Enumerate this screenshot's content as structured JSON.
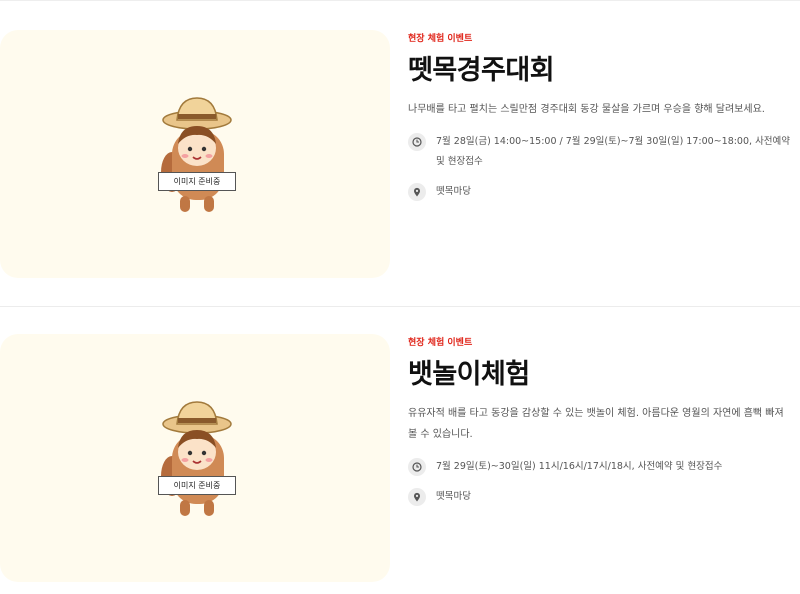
{
  "events": [
    {
      "badge": "현장 체험 이벤트",
      "title": "뗏목경주대회",
      "description": "나무배를 타고 펼치는 스릴만점 경주대회 동강 물살을 가르며 우승을 향해 달려보세요.",
      "schedule": "7월 28일(금) 14:00~15:00 / 7월 29일(토)~7월 30일(일) 17:00~18:00, 사전예약 및 현장접수",
      "location": "뗏목마당",
      "image_placeholder": "이미지 준비중",
      "icons": {
        "schedule": "clock-icon",
        "location": "map-pin-icon"
      }
    },
    {
      "badge": "현장 체험 이벤트",
      "title": "뱃놀이체험",
      "description": "유유자적 배를 타고 동강을 감상할 수 있는 뱃놀이 체험. 아름다운 영월의 자연에 흠뻑 빠져볼 수 있습니다.",
      "schedule": "7월 29일(토)~30일(일) 11시/16시/17시/18시, 사전예약 및 현장접수",
      "location": "뗏목마당",
      "image_placeholder": "이미지 준비중",
      "icons": {
        "schedule": "clock-icon",
        "location": "map-pin-icon"
      }
    }
  ],
  "colors": {
    "badge": "#e0261b",
    "thumb_bg": "#fffbee",
    "title": "#111111"
  }
}
